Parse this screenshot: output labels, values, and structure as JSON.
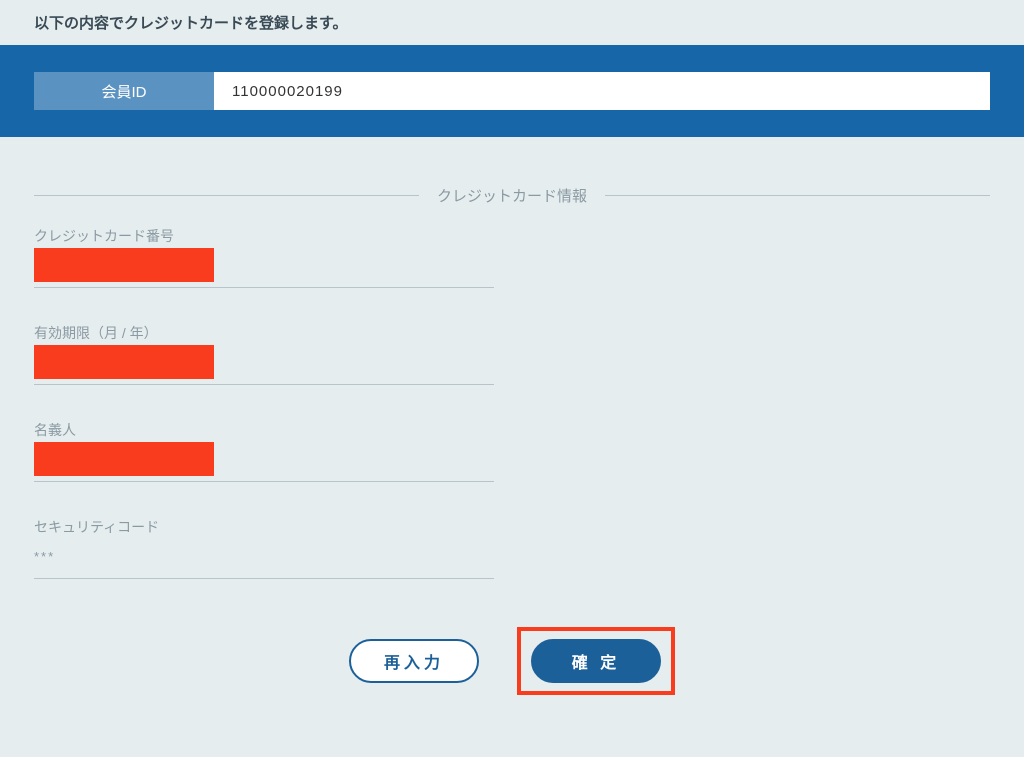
{
  "instruction": "以下の内容でクレジットカードを登録します。",
  "member": {
    "label": "会員ID",
    "value": "110000020199"
  },
  "section": {
    "title": "クレジットカード情報"
  },
  "fields": {
    "card_number": {
      "label": "クレジットカード番号",
      "value": ""
    },
    "expiry": {
      "label": "有効期限（月 / 年）",
      "value": ""
    },
    "holder": {
      "label": "名義人",
      "value": ""
    },
    "security": {
      "label": "セキュリティコード",
      "value": "***"
    }
  },
  "buttons": {
    "reinput": "再入力",
    "confirm": "確 定"
  }
}
